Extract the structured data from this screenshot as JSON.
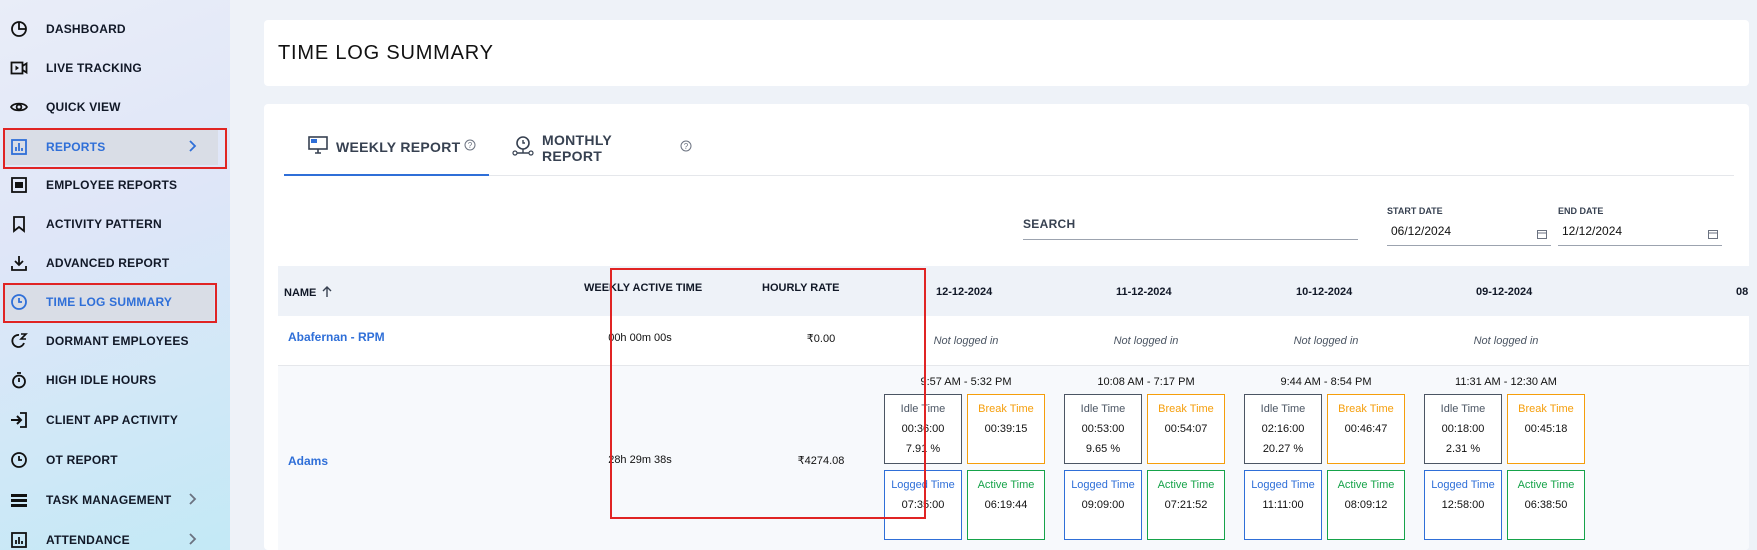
{
  "sidebar": {
    "items": [
      {
        "label": "DASHBOARD",
        "icon": "pie-chart-icon"
      },
      {
        "label": "LIVE TRACKING",
        "icon": "video-icon"
      },
      {
        "label": "QUICK VIEW",
        "icon": "eye-icon"
      },
      {
        "label": "REPORTS",
        "icon": "bar-report-icon"
      },
      {
        "label": "EMPLOYEE REPORTS",
        "icon": "employee-report-icon"
      },
      {
        "label": "ACTIVITY PATTERN",
        "icon": "bookmark-icon"
      },
      {
        "label": "ADVANCED REPORT",
        "icon": "download-icon"
      },
      {
        "label": "TIME LOG SUMMARY",
        "icon": "clock-icon"
      },
      {
        "label": "DORMANT EMPLOYEES",
        "icon": "sleep-icon"
      },
      {
        "label": "HIGH IDLE HOURS",
        "icon": "stopwatch-icon"
      },
      {
        "label": "CLIENT APP ACTIVITY",
        "icon": "sign-in-icon"
      },
      {
        "label": "OT REPORT",
        "icon": "clock-icon"
      },
      {
        "label": "TASK MANAGEMENT",
        "icon": "tasks-icon"
      },
      {
        "label": "ATTENDANCE",
        "icon": "attendance-icon"
      }
    ]
  },
  "page": {
    "title": "TIME LOG SUMMARY"
  },
  "tabs": [
    {
      "label": "WEEKLY REPORT",
      "active": true
    },
    {
      "label": "MONTHLY REPORT",
      "active": false
    }
  ],
  "filters": {
    "search_placeholder": "SEARCH",
    "start_date_label": "START DATE",
    "start_date": "06/12/2024",
    "end_date_label": "END DATE",
    "end_date": "12/12/2024"
  },
  "table": {
    "headers": {
      "name": "NAME",
      "weekly_active_time": "WEEKLY ACTIVE TIME",
      "hourly_rate": "HOURLY RATE",
      "dates": [
        "12-12-2024",
        "11-12-2024",
        "10-12-2024",
        "09-12-2024",
        "08"
      ]
    },
    "rows": [
      {
        "name": "Abafernan - RPM",
        "weekly_active_time": "00h 00m 00s",
        "hourly_rate": "₹0.00",
        "days": [
          "Not logged in",
          "Not logged in",
          "Not logged in",
          "Not logged in"
        ]
      },
      {
        "name": "Adams",
        "weekly_active_time": "28h 29m 38s",
        "hourly_rate": "₹4274.08",
        "days": [
          {
            "range": "9:57 AM - 5:32 PM",
            "idle": "00:36:00",
            "idle_pct": "7.91 %",
            "break": "00:39:15",
            "logged": "07:35:00",
            "active": "06:19:44"
          },
          {
            "range": "10:08 AM - 7:17 PM",
            "idle": "00:53:00",
            "idle_pct": "9.65 %",
            "break": "00:54:07",
            "logged": "09:09:00",
            "active": "07:21:52"
          },
          {
            "range": "9:44 AM - 8:54 PM",
            "idle": "02:16:00",
            "idle_pct": "20.27 %",
            "break": "00:46:47",
            "logged": "11:11:00",
            "active": "08:09:12"
          },
          {
            "range": "11:31 AM - 12:30 AM",
            "idle": "00:18:00",
            "idle_pct": "2.31 %",
            "break": "00:45:18",
            "logged": "12:58:00",
            "active": "06:38:50"
          }
        ]
      }
    ],
    "box_labels": {
      "idle": "Idle Time",
      "break": "Break Time",
      "logged": "Logged Time",
      "active": "Active Time"
    }
  },
  "colors": {
    "accent": "#2f6fd8",
    "highlight": "#e02424",
    "break": "#f59e0b",
    "active": "#16a34a"
  }
}
